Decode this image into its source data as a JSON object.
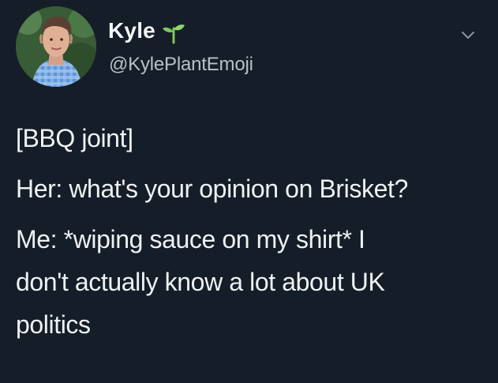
{
  "user": {
    "display_name": "Kyle",
    "handle": "@KylePlantEmoji",
    "name_icon": "seedling-icon"
  },
  "tweet": {
    "lines": [
      "[BBQ joint]",
      "Her: what's your opinion on Brisket?",
      "Me: *wiping sauce on my shirt* I",
      "don't actually know a lot about UK",
      "politics"
    ]
  },
  "menu": {
    "icon": "chevron-down-icon"
  },
  "colors": {
    "background": "#151d28",
    "text_primary": "#eef2f5",
    "text_secondary": "#b7c0c8",
    "plant_green": "#7cc95a"
  }
}
